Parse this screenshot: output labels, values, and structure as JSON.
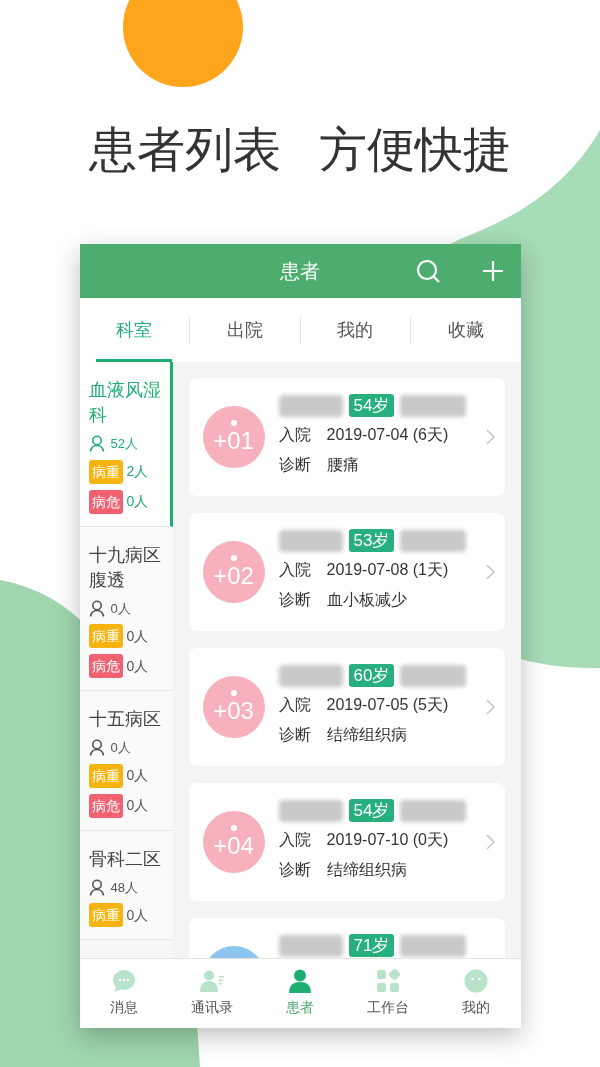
{
  "headline": [
    "患者列表",
    "方便快捷"
  ],
  "header": {
    "title": "患者"
  },
  "tabs": [
    {
      "label": "科室",
      "selected": true
    },
    {
      "label": "出院",
      "selected": false
    },
    {
      "label": "我的",
      "selected": false
    },
    {
      "label": "收藏",
      "selected": false
    }
  ],
  "departments": [
    {
      "name": "血液风湿科",
      "selected": true,
      "stats": [
        {
          "kind": "total",
          "value": "52人"
        },
        {
          "kind": "severe",
          "label": "病重",
          "value": "2人"
        },
        {
          "kind": "critical",
          "label": "病危",
          "value": "0人"
        }
      ]
    },
    {
      "name": "十九病区腹透",
      "selected": false,
      "stats": [
        {
          "kind": "total",
          "value": "0人"
        },
        {
          "kind": "severe",
          "label": "病重",
          "value": "0人"
        },
        {
          "kind": "critical",
          "label": "病危",
          "value": "0人"
        }
      ]
    },
    {
      "name": "十五病区",
      "selected": false,
      "stats": [
        {
          "kind": "total",
          "value": "0人"
        },
        {
          "kind": "severe",
          "label": "病重",
          "value": "0人"
        },
        {
          "kind": "critical",
          "label": "病危",
          "value": "0人"
        }
      ]
    },
    {
      "name": "骨科二区",
      "selected": false,
      "stats": [
        {
          "kind": "total",
          "value": "48人"
        },
        {
          "kind": "severe",
          "label": "病重",
          "value": "0人"
        }
      ]
    }
  ],
  "patients": [
    {
      "bed": "+01",
      "color": "#f6b1bd",
      "age": "54岁",
      "admitted_label": "入院",
      "admitted": "2019-07-04 (6天)",
      "diagnosis_label": "诊断",
      "diagnosis": "腰痛"
    },
    {
      "bed": "+02",
      "color": "#f6b1bd",
      "age": "53岁",
      "admitted_label": "入院",
      "admitted": "2019-07-08 (1天)",
      "diagnosis_label": "诊断",
      "diagnosis": "血小板减少"
    },
    {
      "bed": "+03",
      "color": "#f6b1bd",
      "age": "60岁",
      "admitted_label": "入院",
      "admitted": "2019-07-05 (5天)",
      "diagnosis_label": "诊断",
      "diagnosis": "结缔组织病"
    },
    {
      "bed": "+04",
      "color": "#f6b1bd",
      "age": "54岁",
      "admitted_label": "入院",
      "admitted": "2019-07-10 (0天)",
      "diagnosis_label": "诊断",
      "diagnosis": "结缔组织病"
    },
    {
      "color": "#8ec5f0",
      "age": "71岁"
    }
  ],
  "bottom_nav": [
    {
      "label": "消息",
      "kind": "chat",
      "selected": false
    },
    {
      "label": "通讯录",
      "kind": "contacts",
      "selected": false
    },
    {
      "label": "患者",
      "kind": "person",
      "selected": true
    },
    {
      "label": "工作台",
      "kind": "grid",
      "selected": false
    },
    {
      "label": "我的",
      "kind": "face",
      "selected": false
    }
  ]
}
